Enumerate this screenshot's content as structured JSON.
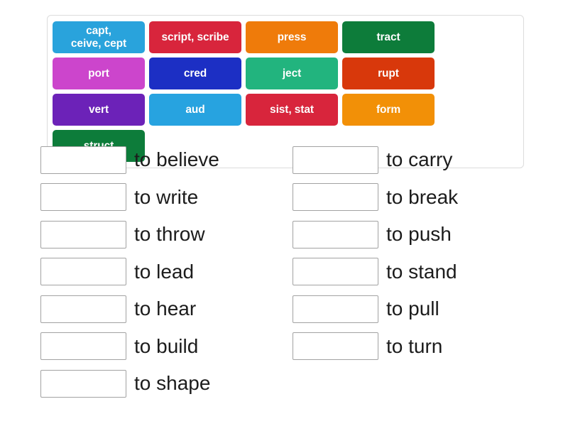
{
  "activity": {
    "type": "match-up",
    "word_bank": {
      "tiles": [
        {
          "label": "capt,\nceive, cept",
          "color": "#29a3dc"
        },
        {
          "label": "script, scribe",
          "color": "#d8253c"
        },
        {
          "label": "press",
          "color": "#ef7b0a"
        },
        {
          "label": "tract",
          "color": "#0d7c3a"
        },
        {
          "label": "port",
          "color": "#cc45cc"
        },
        {
          "label": "cred",
          "color": "#1c2fc4"
        },
        {
          "label": "ject",
          "color": "#22b47e"
        },
        {
          "label": "rupt",
          "color": "#d8380b"
        },
        {
          "label": "vert",
          "color": "#6c22b8"
        },
        {
          "label": "aud",
          "color": "#27a3e0"
        },
        {
          "label": "sist, stat",
          "color": "#d8253c"
        },
        {
          "label": "form",
          "color": "#f29007"
        },
        {
          "label": "struct",
          "color": "#0d7c3a"
        }
      ]
    },
    "columns": [
      {
        "name": "left",
        "rows": [
          {
            "definition": "to believe",
            "answer": ""
          },
          {
            "definition": "to write",
            "answer": ""
          },
          {
            "definition": "to throw",
            "answer": ""
          },
          {
            "definition": "to lead",
            "answer": ""
          },
          {
            "definition": "to hear",
            "answer": ""
          },
          {
            "definition": "to build",
            "answer": ""
          },
          {
            "definition": "to shape",
            "answer": ""
          }
        ]
      },
      {
        "name": "right",
        "rows": [
          {
            "definition": "to carry",
            "answer": ""
          },
          {
            "definition": "to break",
            "answer": ""
          },
          {
            "definition": "to push",
            "answer": ""
          },
          {
            "definition": "to stand",
            "answer": ""
          },
          {
            "definition": "to pull",
            "answer": ""
          },
          {
            "definition": "to turn",
            "answer": ""
          }
        ]
      }
    ]
  }
}
